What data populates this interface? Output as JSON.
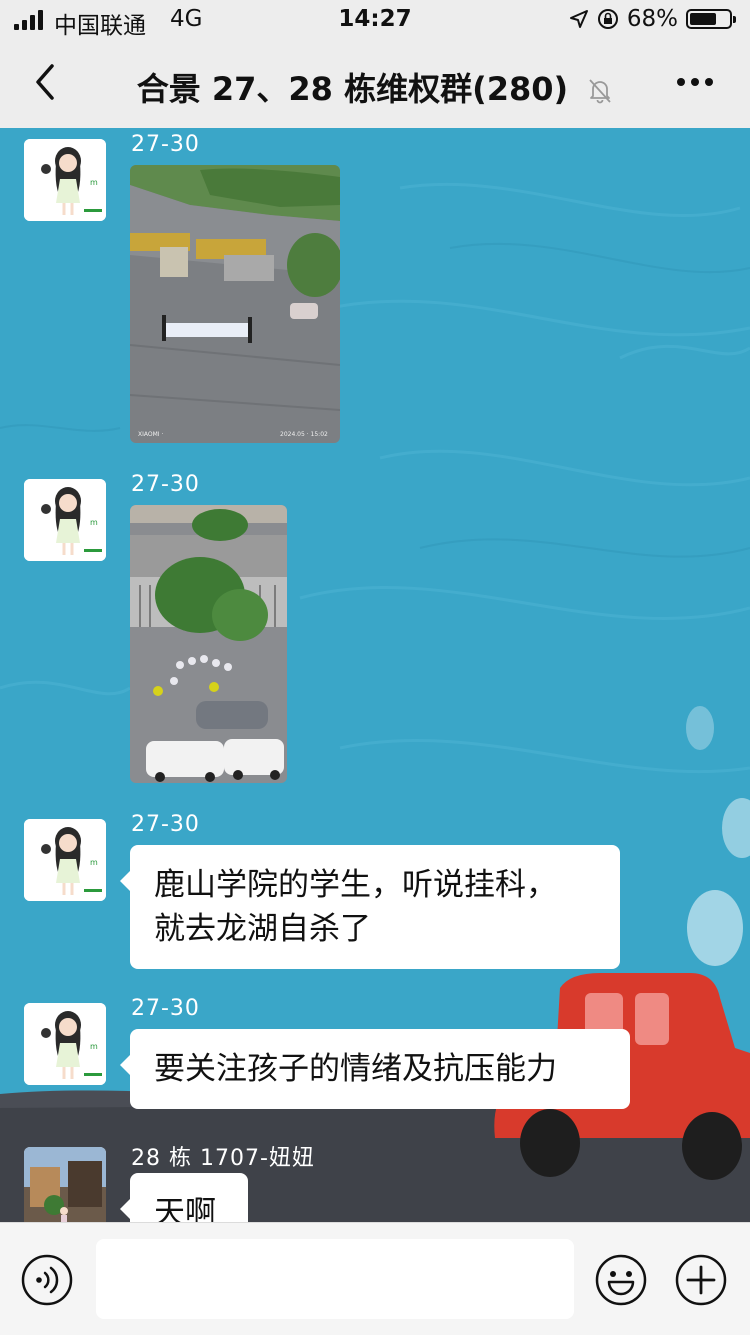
{
  "status_bar": {
    "carrier": "中国联通",
    "network": "4G",
    "time": "14:27",
    "battery_text": "68%",
    "battery_level": 0.68
  },
  "nav": {
    "title": "合景 27、28 栋维权群(280)"
  },
  "messages": [
    {
      "sender": "27-30",
      "type": "image",
      "watermark_left": "XIAOMI ·",
      "watermark_right": "2024.05 · 15:02"
    },
    {
      "sender": "27-30",
      "type": "image"
    },
    {
      "sender": "27-30",
      "type": "text",
      "lines": [
        "鹿山学院的学生，听说挂科，",
        "就去龙湖自杀了"
      ]
    },
    {
      "sender": "27-30",
      "type": "text",
      "lines": [
        "要关注孩子的情绪及抗压能力"
      ]
    },
    {
      "sender": "28 栋 1707-妞妞",
      "type": "text",
      "lines": [
        "天啊"
      ]
    }
  ],
  "input_bar": {
    "value": "",
    "icons": [
      "voice-icon",
      "emoji-icon",
      "plus-icon"
    ]
  },
  "colors": {
    "chat_background": "#3aa6c8",
    "bar_background": "#ededed",
    "car": "#d83a2c"
  }
}
